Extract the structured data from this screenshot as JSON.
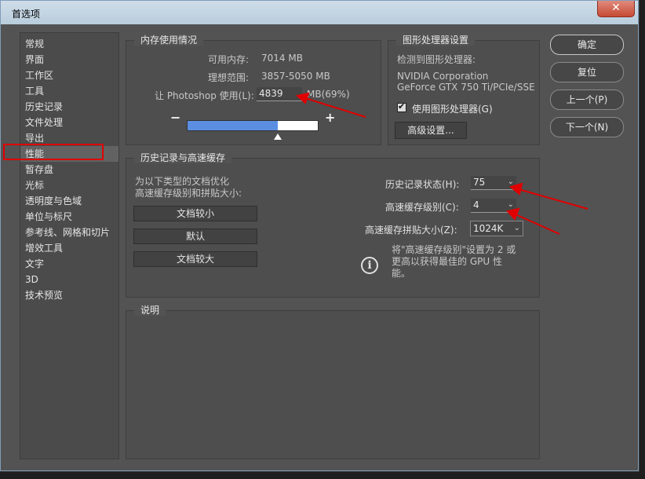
{
  "window": {
    "title": "首选项",
    "close_glyph": "✕"
  },
  "sidebar": {
    "items": [
      {
        "label": "常规"
      },
      {
        "label": "界面"
      },
      {
        "label": "工作区"
      },
      {
        "label": "工具"
      },
      {
        "label": "历史记录"
      },
      {
        "label": "文件处理"
      },
      {
        "label": "导出"
      },
      {
        "label": "性能"
      },
      {
        "label": "暂存盘"
      },
      {
        "label": "光标"
      },
      {
        "label": "透明度与色域"
      },
      {
        "label": "单位与标尺"
      },
      {
        "label": "参考线、网格和切片"
      },
      {
        "label": "增效工具"
      },
      {
        "label": "文字"
      },
      {
        "label": "3D"
      },
      {
        "label": "技术预览"
      }
    ],
    "selected": "性能"
  },
  "memory": {
    "title": "内存使用情况",
    "available_label": "可用内存:",
    "available_value": "7014 MB",
    "ideal_label": "理想范围:",
    "ideal_value": "3857-5050 MB",
    "use_label": "让 Photoshop 使用(L):",
    "use_value": "4839",
    "use_suffix": "MB(69%)",
    "minus": "−",
    "plus": "+",
    "slider_percent": 69
  },
  "gpu": {
    "title": "图形处理器设置",
    "detected_label": "检测到图形处理器:",
    "vendor": "NVIDIA Corporation",
    "model": "GeForce GTX 750 Ti/PCIe/SSE",
    "use_gpu_label": "使用图形处理器(G)",
    "use_gpu_checked": true,
    "check_glyph": "✔",
    "advanced_button": "高级设置..."
  },
  "history": {
    "title": "历史记录与高速缓存",
    "optimize_line1": "为以下类型的文档优化",
    "optimize_line2": "高速缓存级别和拼贴大小:",
    "btn_small": "文档较小",
    "btn_default": "默认",
    "btn_large": "文档较大",
    "history_states_label": "历史记录状态(H):",
    "history_states_value": "75",
    "cache_levels_label": "高速缓存级别(C):",
    "cache_levels_value": "4",
    "tile_size_label": "高速缓存拼贴大小(Z):",
    "tile_size_value": "1024K",
    "chevron": "⌄",
    "info_line1": "将\"高速缓存级别\"设置为 2 或",
    "info_line2": "更高以获得最佳的 GPU 性",
    "info_line3": "能。",
    "info_glyph": "i"
  },
  "description": {
    "title": "说明"
  },
  "buttons": {
    "ok": "确定",
    "reset": "复位",
    "prev": "上一个(P)",
    "next": "下一个(N)"
  },
  "colors": {
    "annotation": "#e00000",
    "slider_fill": "#5b8ee0"
  }
}
